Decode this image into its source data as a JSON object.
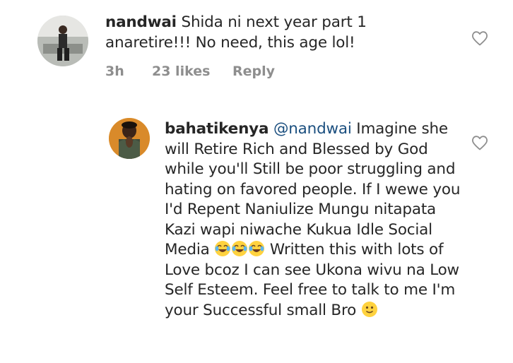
{
  "comments": [
    {
      "username": "nandwai",
      "text": "Shida ni next year part 1 anaretire!!! No need, this age lol!",
      "time": "3h",
      "likes": "23 likes",
      "reply": "Reply"
    },
    {
      "username": "bahatikenya",
      "mention": "@nandwai",
      "text_part1": "Imagine she will Retire Rich and Blessed by God while you'll Still be poor struggling and hating on favored people. If I wewe you I'd Repent Naniulize Mungu nitapata Kazi wapi niwache Kukua Idle Social Media",
      "text_part2": "Written this with lots of Love bcoz I can see Ukona wivu na Low Self Esteem. Feel free to talk to me I'm your Successful small Bro",
      "emojis_mid": [
        "laughing-tears-emoji",
        "laughing-tears-emoji",
        "laughing-tears-emoji"
      ],
      "emoji_end": "slightly-smiling-emoji"
    }
  ],
  "icons": {
    "like": "heart-outline-icon"
  },
  "colors": {
    "text": "#262626",
    "meta": "#8e8e8e",
    "mention": "#1b4f7f",
    "heart": "#8e8e8e"
  }
}
